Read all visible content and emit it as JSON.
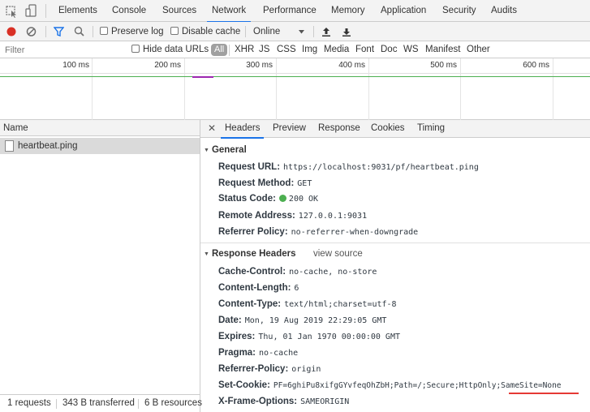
{
  "panel_tabs": [
    "Elements",
    "Console",
    "Sources",
    "Network",
    "Performance",
    "Memory",
    "Application",
    "Security",
    "Audits"
  ],
  "active_panel_tab": "Network",
  "toolbar": {
    "preserve_log": "Preserve log",
    "disable_cache": "Disable cache",
    "throttling": "Online"
  },
  "filterbar": {
    "placeholder": "Filter",
    "hide_data_urls": "Hide data URLs",
    "types": [
      "All",
      "XHR",
      "JS",
      "CSS",
      "Img",
      "Media",
      "Font",
      "Doc",
      "WS",
      "Manifest",
      "Other"
    ]
  },
  "overview": {
    "tick_labels": [
      "100 ms",
      "200 ms",
      "300 ms",
      "400 ms",
      "500 ms",
      "600 ms"
    ]
  },
  "request_list": {
    "header": "Name",
    "rows": [
      "heartbeat.ping"
    ]
  },
  "status_bar": {
    "requests": "1 requests",
    "transferred": "343 B transferred",
    "resources": "6 B resources"
  },
  "detail_tabs": [
    "Headers",
    "Preview",
    "Response",
    "Cookies",
    "Timing"
  ],
  "active_detail_tab": "Headers",
  "general": {
    "title": "General",
    "rows": [
      {
        "key": "Request URL:",
        "value": "https://localhost:9031/pf/heartbeat.ping"
      },
      {
        "key": "Request Method:",
        "value": "GET"
      },
      {
        "key": "Status Code:",
        "value": "200 OK"
      },
      {
        "key": "Remote Address:",
        "value": "127.0.0.1:9031"
      },
      {
        "key": "Referrer Policy:",
        "value": "no-referrer-when-downgrade"
      }
    ]
  },
  "response_headers": {
    "title": "Response Headers",
    "view_source": "view source",
    "rows": [
      {
        "key": "Cache-Control:",
        "value": "no-cache, no-store"
      },
      {
        "key": "Content-Length:",
        "value": "6"
      },
      {
        "key": "Content-Type:",
        "value": "text/html;charset=utf-8"
      },
      {
        "key": "Date:",
        "value": "Mon, 19 Aug 2019 22:29:05 GMT"
      },
      {
        "key": "Expires:",
        "value": "Thu, 01 Jan 1970 00:00:00 GMT"
      },
      {
        "key": "Pragma:",
        "value": "no-cache"
      },
      {
        "key": "Referrer-Policy:",
        "value": "origin"
      },
      {
        "key": "Set-Cookie:",
        "value": "PF=6ghiPu8xifgGYvfeqOhZbH;Path=/;Secure;HttpOnly;SameSite=None"
      },
      {
        "key": "X-Frame-Options:",
        "value": "SAMEORIGIN"
      }
    ]
  },
  "colors": {
    "accent": "#1a73e8",
    "record": "#d93025",
    "status_ok": "#4caf50",
    "highlight_underline": "#e53935"
  },
  "icons": [
    "inspect-icon",
    "device-toolbar-icon",
    "record-icon",
    "clear-icon",
    "filter-icon",
    "search-icon",
    "throttle-dropdown-icon",
    "import-har-icon",
    "export-har-icon",
    "file-icon",
    "close-icon"
  ]
}
